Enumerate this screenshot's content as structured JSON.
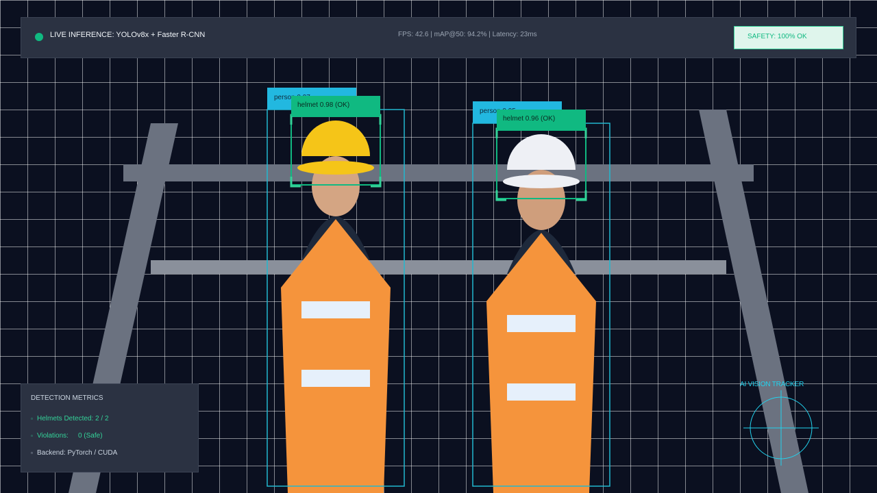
{
  "header": {
    "live_title": "LIVE INFERENCE: YOLOv8x + Faster R-CNN",
    "stats": "FPS: 42.6 | mAP@50: 94.2% | Latency: 23ms",
    "safety": "SAFETY: 100% OK"
  },
  "detections": [
    {
      "person_label": "person 0.97",
      "helmet_label": "helmet 0.98 (OK)",
      "helmet_color": "#f5c518"
    },
    {
      "person_label": "person 0.95",
      "helmet_label": "helmet 0.96 (OK)",
      "helmet_color": "#eef0f5"
    }
  ],
  "metrics": {
    "title": "DETECTION METRICS",
    "helmets_label": "Helmets Detected:",
    "helmets_value": "2 / 2",
    "violations_label": "Violations:",
    "violations_value": "0 (Safe)",
    "backend": "Backend: PyTorch / CUDA"
  },
  "tracker": {
    "label": "AI VISION TRACKER"
  },
  "colors": {
    "accent_green": "#10b981",
    "accent_cyan": "#22d3ee",
    "vest_orange": "#f5943c",
    "background": "#0b1020"
  }
}
